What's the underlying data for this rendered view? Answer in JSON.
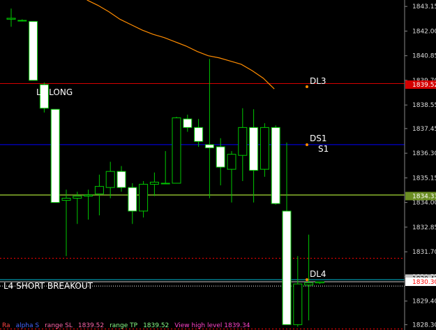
{
  "price_axis": {
    "ticks": [
      "1843.15",
      "1842.00",
      "1840.85",
      "1839.70",
      "1838.55",
      "1837.45",
      "1836.30",
      "1835.15",
      "1834.00",
      "1832.85",
      "1831.70",
      "1830.55",
      "1829.40",
      "1828.30"
    ],
    "tags": [
      {
        "price": 1839.5,
        "text": "1839.52",
        "bg": "#d40000",
        "fg": "#ffffff"
      },
      {
        "price": 1834.3,
        "text": "1834.33",
        "bg": "#6b8e23",
        "fg": "#ffffff"
      },
      {
        "price": 1830.45,
        "text": "1830.42",
        "bg": "#c0c0c0",
        "fg": "#000000"
      },
      {
        "price": 1830.3,
        "text": "1830.30",
        "bg": "#ffffff",
        "fg": "#ff0000"
      }
    ]
  },
  "levels": {
    "dl3": {
      "label": "DL3",
      "price": 1839.55,
      "color": "#d40000"
    },
    "ds1": {
      "label": "DS1",
      "sub": "S1",
      "price": 1836.7,
      "color": "#0000ff"
    },
    "green": {
      "price": 1834.35,
      "color": "#6b8e23"
    },
    "dl4": {
      "label": "DL4",
      "price": 1830.3,
      "color": "#ffffff"
    }
  },
  "labels": {
    "l3_long": "L3 LONG",
    "l4_short": "L4 SHORT BREAKOUT"
  },
  "bottom_bar": [
    {
      "text": "Ra",
      "color": "#ff4444"
    },
    {
      "text": "alpha S",
      "color": "#4466ff"
    },
    {
      "text": "range SL",
      "color": "#ff66aa"
    },
    {
      "text": "1839.52",
      "color": "#ff66aa"
    },
    {
      "text": "range TP",
      "color": "#88ff88"
    },
    {
      "text": "1839.52",
      "color": "#88ff88"
    },
    {
      "text": "View high level 1839.34",
      "color": "#ff44cc"
    }
  ],
  "chart_data": {
    "type": "candlestick",
    "y_range": [
      1828.05,
      1843.45
    ],
    "candles": [
      {
        "o": 1842.55,
        "h": 1843.05,
        "l": 1842.2,
        "c": 1842.6
      },
      {
        "o": 1842.5,
        "h": 1842.55,
        "l": 1842.45,
        "c": 1842.5
      },
      {
        "o": 1842.45,
        "h": 1842.45,
        "l": 1839.7,
        "c": 1839.7
      },
      {
        "o": 1839.5,
        "h": 1839.6,
        "l": 1838.2,
        "c": 1838.4
      },
      {
        "o": 1838.35,
        "h": 1838.35,
        "l": 1834.0,
        "c": 1834.0
      },
      {
        "o": 1834.1,
        "h": 1834.6,
        "l": 1831.5,
        "c": 1834.2
      },
      {
        "o": 1834.2,
        "h": 1834.5,
        "l": 1833.0,
        "c": 1834.3
      },
      {
        "o": 1834.3,
        "h": 1834.6,
        "l": 1833.2,
        "c": 1834.35
      },
      {
        "o": 1834.4,
        "h": 1835.3,
        "l": 1833.4,
        "c": 1834.75
      },
      {
        "o": 1834.7,
        "h": 1835.9,
        "l": 1834.2,
        "c": 1835.45
      },
      {
        "o": 1835.45,
        "h": 1835.7,
        "l": 1834.5,
        "c": 1834.7
      },
      {
        "o": 1834.7,
        "h": 1834.9,
        "l": 1833.0,
        "c": 1833.6
      },
      {
        "o": 1833.6,
        "h": 1835.0,
        "l": 1833.3,
        "c": 1834.85
      },
      {
        "o": 1834.85,
        "h": 1835.4,
        "l": 1834.3,
        "c": 1834.95
      },
      {
        "o": 1834.9,
        "h": 1836.4,
        "l": 1834.9,
        "c": 1834.9
      },
      {
        "o": 1834.9,
        "h": 1838.0,
        "l": 1834.9,
        "c": 1837.95
      },
      {
        "o": 1837.9,
        "h": 1838.1,
        "l": 1837.3,
        "c": 1837.5
      },
      {
        "o": 1837.5,
        "h": 1837.9,
        "l": 1836.6,
        "c": 1836.85
      },
      {
        "o": 1836.7,
        "h": 1840.7,
        "l": 1834.2,
        "c": 1836.55
      },
      {
        "o": 1836.6,
        "h": 1837.0,
        "l": 1834.8,
        "c": 1835.65
      },
      {
        "o": 1835.55,
        "h": 1836.4,
        "l": 1834.0,
        "c": 1836.25
      },
      {
        "o": 1836.2,
        "h": 1838.4,
        "l": 1835.0,
        "c": 1837.5
      },
      {
        "o": 1837.5,
        "h": 1838.35,
        "l": 1834.0,
        "c": 1835.5
      },
      {
        "o": 1835.55,
        "h": 1837.7,
        "l": 1835.2,
        "c": 1837.5
      },
      {
        "o": 1837.5,
        "h": 1837.6,
        "l": 1833.9,
        "c": 1833.95
      },
      {
        "o": 1833.6,
        "h": 1836.8,
        "l": 1832.3,
        "c": 1828.3
      },
      {
        "o": 1828.3,
        "h": 1831.5,
        "l": 1828.2,
        "c": 1830.2
      },
      {
        "o": 1830.15,
        "h": 1832.5,
        "l": 1828.5,
        "c": 1830.25
      },
      {
        "o": 1830.25,
        "h": 1830.3,
        "l": 1830.2,
        "c": 1830.3
      }
    ],
    "moving_average": [
      {
        "i": 7,
        "v": 1843.45
      },
      {
        "i": 8,
        "v": 1843.2
      },
      {
        "i": 9,
        "v": 1842.9
      },
      {
        "i": 10,
        "v": 1842.55
      },
      {
        "i": 11,
        "v": 1842.3
      },
      {
        "i": 12,
        "v": 1842.05
      },
      {
        "i": 13,
        "v": 1841.85
      },
      {
        "i": 14,
        "v": 1841.7
      },
      {
        "i": 15,
        "v": 1841.5
      },
      {
        "i": 16,
        "v": 1841.3
      },
      {
        "i": 17,
        "v": 1841.05
      },
      {
        "i": 18,
        "v": 1840.85
      },
      {
        "i": 19,
        "v": 1840.75
      },
      {
        "i": 20,
        "v": 1840.6
      },
      {
        "i": 21,
        "v": 1840.45
      },
      {
        "i": 22,
        "v": 1840.15
      },
      {
        "i": 23,
        "v": 1839.8
      },
      {
        "i": 24,
        "v": 1839.3
      }
    ]
  }
}
